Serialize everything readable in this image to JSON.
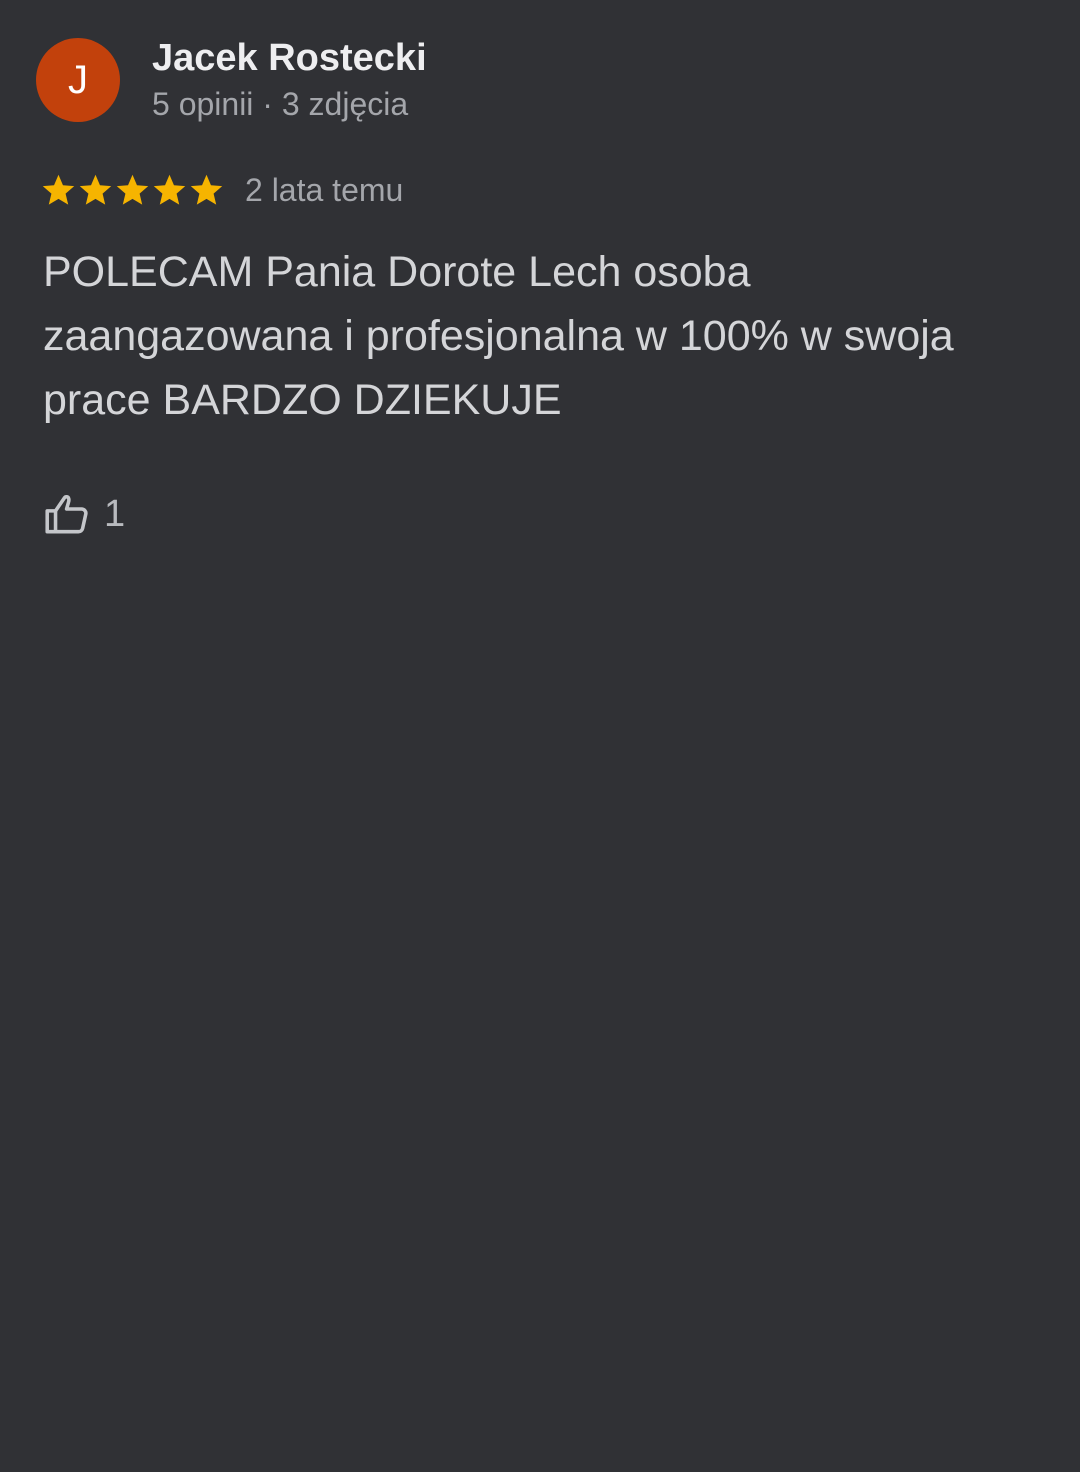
{
  "reviewer": {
    "avatar_letter": "J",
    "avatar_color": "#c2410c",
    "name": "Jacek Rostecki",
    "meta": "5 opinii · 3 zdjęcia"
  },
  "review": {
    "rating": 5,
    "rating_max": 5,
    "star_color": "#f6b400",
    "date": "2 lata temu",
    "text": "POLECAM Pania Dorote Lech osoba zaangazowana i profesjonalna w 100% w swoja prace BARDZO DZIEKUJE"
  },
  "actions": {
    "like_icon": "thumb-up-icon",
    "like_count": "1"
  }
}
